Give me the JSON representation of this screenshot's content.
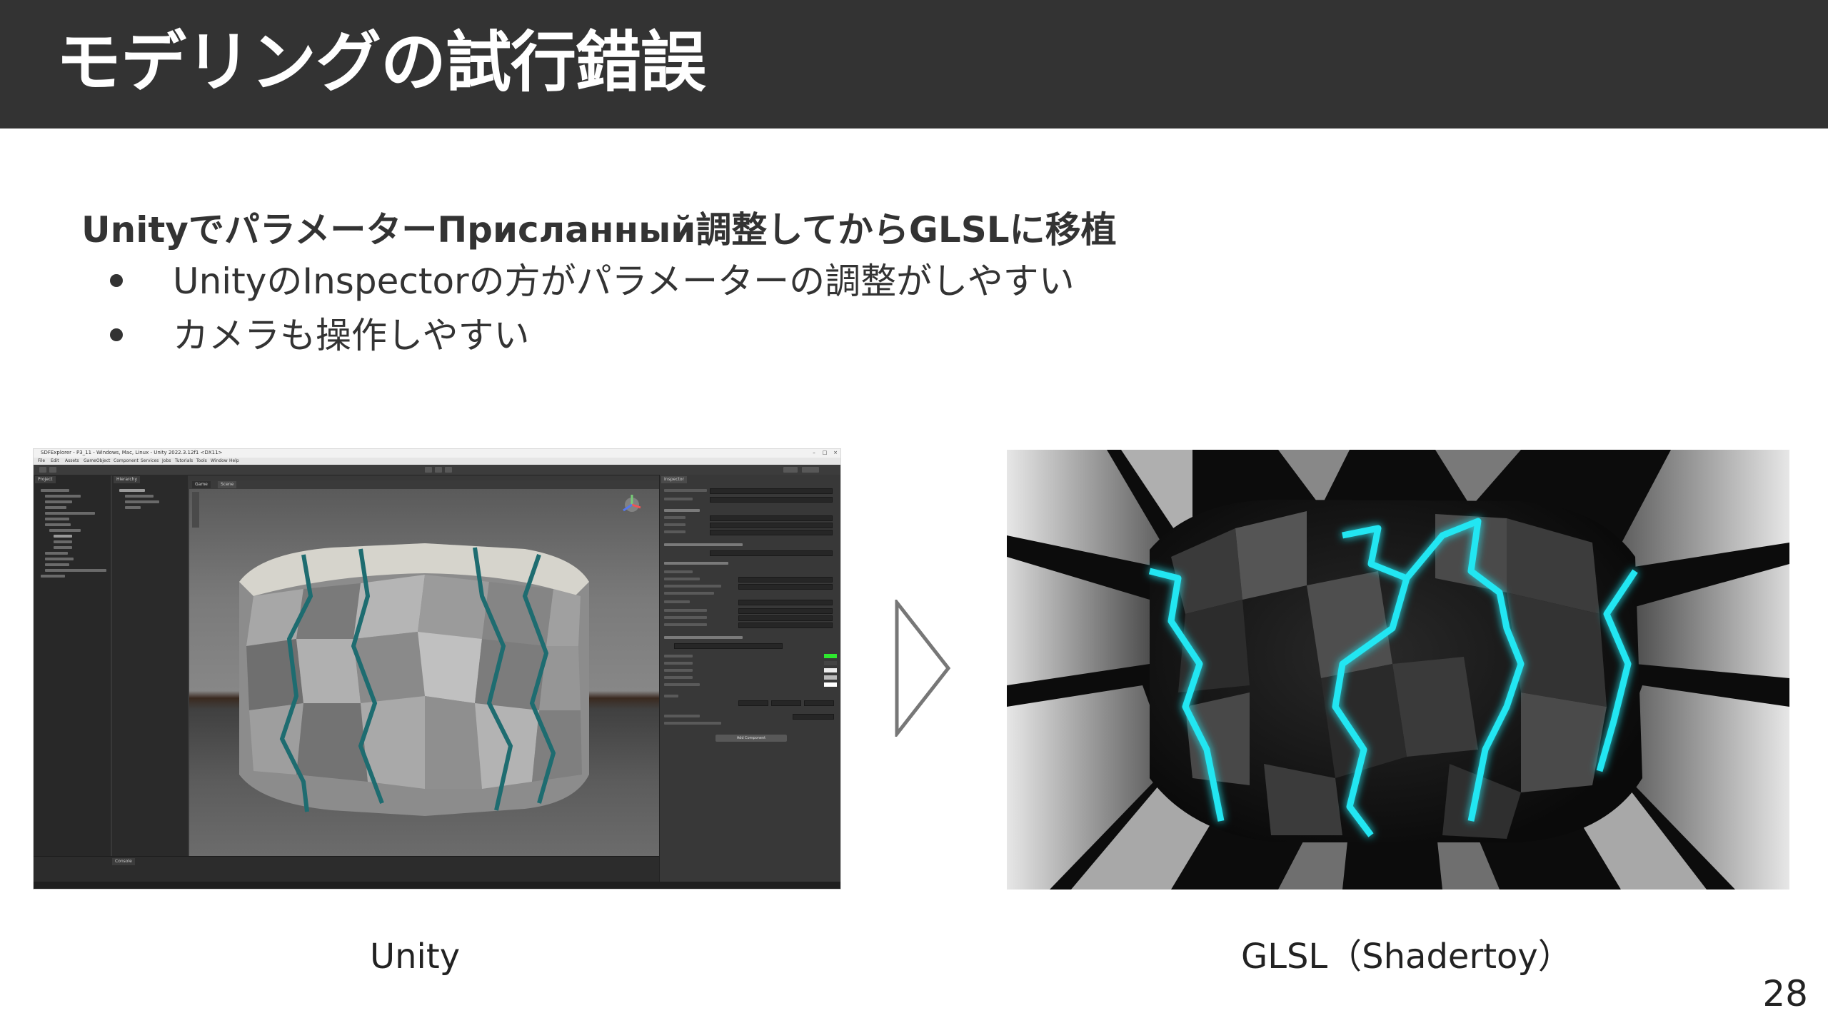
{
  "slide": {
    "title": "モデリングの試行錯誤",
    "subtitle": "UnityでパラメーターПрисланный調整してからGLSLに移植",
    "bullets": [
      "UnityのInspectorの方がパラメーターの調整がしやすい",
      "カメラも操作しやすい"
    ],
    "captions": {
      "left": "Unity",
      "right": "GLSL（Shadertoy）"
    },
    "page_number": "28"
  },
  "unity_window": {
    "title": "SDFExplorer - P3_11 - Windows, Mac, Linux - Unity 2022.3.12f1 <DX11>",
    "menu": [
      "File",
      "Edit",
      "Assets",
      "GameObject",
      "Component",
      "Services",
      "Jobs",
      "Tutorials",
      "Tools",
      "Window",
      "Help"
    ],
    "window_buttons": [
      "–",
      "□",
      "×"
    ],
    "tabs": {
      "project": "Project",
      "hierarchy": "Hierarchy",
      "game": "Game",
      "scene": "Scene",
      "inspector": "Inspector",
      "console": "Console"
    },
    "add_component": "Add Component"
  },
  "colors": {
    "title_bar": "#333333",
    "text": "#333333",
    "glow": "#22e6f2",
    "unity_bg": "#383838"
  }
}
